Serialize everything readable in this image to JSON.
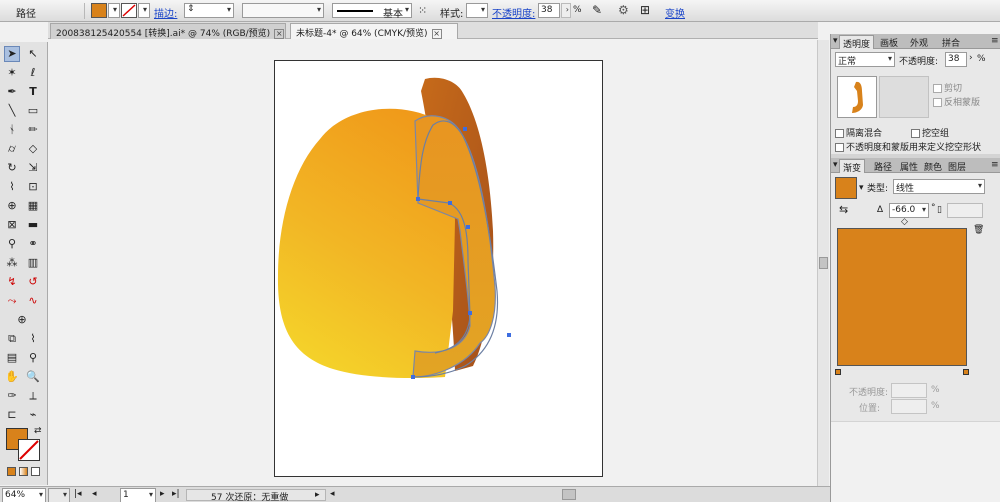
{
  "control_bar": {
    "object_type": "路径",
    "fill_color": "#d8821b",
    "stroke_label": "描边:",
    "style_label": "样式:",
    "stroke_profile": "基本",
    "opacity_label": "不透明度:",
    "opacity_value": "38",
    "percent": "%",
    "transform_label": "变换"
  },
  "tabs": [
    {
      "label": "200838125420554 [转换].ai* @ 74% (RGB/预览)",
      "close": "⊠"
    },
    {
      "label": "未标题-4* @ 64% (CMYK/预览)",
      "close": "⊠"
    }
  ],
  "toolbox": {
    "fill_color": "#d8821b"
  },
  "status": {
    "zoom": "64%",
    "page": "1",
    "history": "57 次还原：无重做"
  },
  "transparency_panel": {
    "tabs": [
      "透明度",
      "画板",
      "外观",
      "拼合"
    ],
    "blend_mode": "正常",
    "opacity_label": "不透明度:",
    "opacity_value": "38",
    "percent": "%",
    "clip_label": "剪切",
    "invert_label": "反相蒙版",
    "isolate_label": "隔离混合",
    "knockout_label": "挖空组",
    "opacity_mask_label": "不透明度和蒙版用来定义挖空形状"
  },
  "gradient_panel": {
    "tabs": [
      "渐变",
      "路径",
      "属性",
      "颜色",
      "图层"
    ],
    "type_label": "类型:",
    "type_value": "线性",
    "angle_value": "-66.0",
    "degree": "°",
    "gradient_color": "#d8821b",
    "opacity_label": "不透明度:",
    "position_label": "位置:",
    "percent": "%"
  }
}
